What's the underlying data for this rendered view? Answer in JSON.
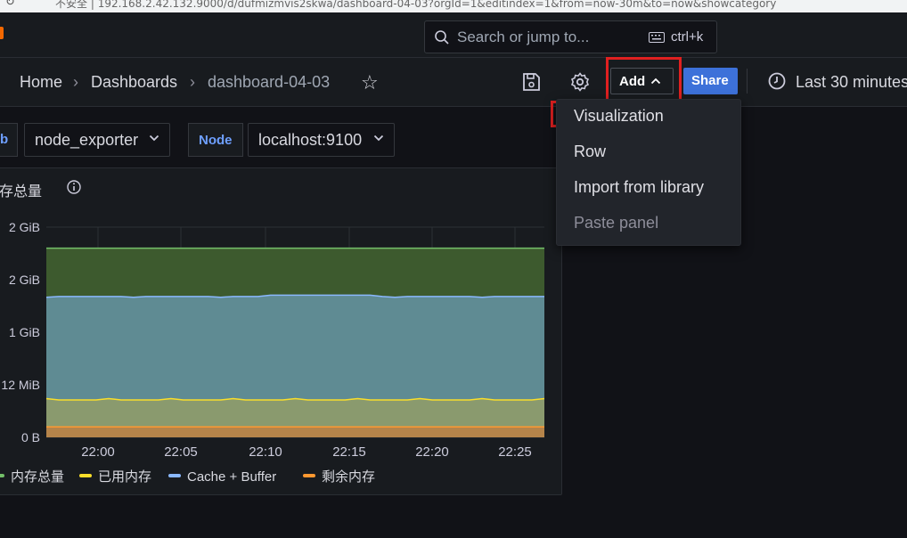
{
  "browser": {
    "url": "192.168.2.42.132.9000/d/dufmizmvis2skwa/dashboard-04-03?orgId=1&editindex=1&from=now-30m&to=now&showcategory",
    "security_label": "不安全"
  },
  "search": {
    "placeholder": "Search or jump to...",
    "shortcut": "ctrl+k",
    "icon": "search-icon"
  },
  "breadcrumb": {
    "home": "Home",
    "dashboards": "Dashboards",
    "current": "dashboard-04-03",
    "separator": "›"
  },
  "toolbar": {
    "add_label": "Add",
    "share_label": "Share",
    "time_range": "Last 30 minutes"
  },
  "variables": [
    {
      "label_fragment": "b",
      "value": "node_exporter"
    },
    {
      "label": "Node",
      "value": "localhost:9100"
    }
  ],
  "add_menu": {
    "items": [
      {
        "label": "Visualization",
        "disabled": false,
        "highlighted": true
      },
      {
        "label": "Row",
        "disabled": false
      },
      {
        "label": "Import from library",
        "disabled": false
      },
      {
        "label": "Paste panel",
        "disabled": true
      }
    ]
  },
  "panel": {
    "title": "存总量"
  },
  "chart_data": {
    "type": "area",
    "x": [
      "22:00",
      "22:05",
      "22:10",
      "22:15",
      "22:20",
      "22:25"
    ],
    "yticks": [
      "0 B",
      "12 MiB",
      "1 GiB",
      "2 GiB",
      "2 GiB"
    ],
    "series": [
      {
        "name": "内存总量",
        "color": "#73bf69",
        "level": 0.9
      },
      {
        "name": "已用内存",
        "color": "#fade2a",
        "level": 0.18
      },
      {
        "name": "Cache + Buffer",
        "color": "#8ab8ff",
        "level": 0.67
      },
      {
        "name": "剩余内存",
        "color": "#ff9830",
        "level": 0.05
      }
    ],
    "legend_position": "bottom"
  }
}
